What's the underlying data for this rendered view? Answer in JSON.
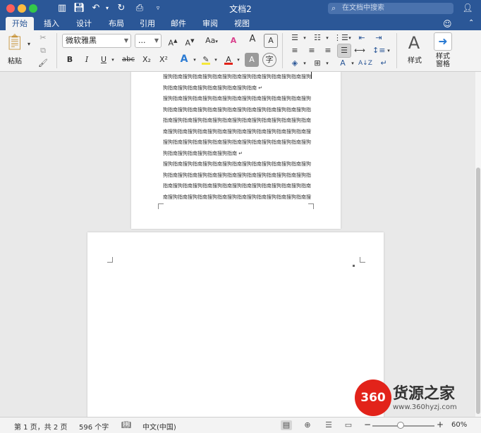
{
  "window": {
    "title": "文档2",
    "search_placeholder": "在文档中搜索"
  },
  "tabs": [
    "开始",
    "插入",
    "设计",
    "布局",
    "引用",
    "邮件",
    "审阅",
    "视图"
  ],
  "active_tab": "开始",
  "ribbon": {
    "paste_label": "粘贴",
    "font_name": "微软雅黑",
    "font_size": "...",
    "grow_font": "A",
    "shrink_font": "A",
    "aa_label": "Aa",
    "clear_format": "A",
    "phonetic": "A",
    "bold": "B",
    "italic": "I",
    "underline": "U",
    "strikethrough": "abc",
    "subscript": "X₂",
    "superscript": "X²",
    "text_effects": "A",
    "font_color": "A",
    "char_shading": "A",
    "enclose_char": "字",
    "styles_label": "样式",
    "styles_pane_label": "样式\n窗格",
    "highlight_color": "#f5e83a",
    "font_color_value": "#e2231a",
    "accent": "#2b5797"
  },
  "document": {
    "paragraphs": [
      [
        "搜狗指南搜狗指南搜狗指南搜狗指南搜狗指南搜狗指南搜狗指南搜狗指南搜",
        "狗指南搜狗指南搜狗指南搜狗指南搜狗指南 ↵"
      ],
      [
        "搜狗指南搜狗指南搜狗指南搜狗指南搜狗指南搜狗指南搜狗指南搜狗指南搜",
        "狗指南搜狗指南搜狗指南搜狗指南搜狗指南搜狗指南搜狗指南搜狗指南搜狗",
        "指南搜狗指南搜狗指南搜狗指南搜狗指南搜狗指南搜狗指南搜狗指南搜狗指",
        "南搜狗指南搜狗指南搜狗指南搜狗指南搜狗指南搜狗指南搜狗指南搜狗指南",
        "搜狗指南搜狗指南搜狗指南搜狗指南搜狗指南搜狗指南搜狗指南搜狗指南搜",
        "狗指南搜狗指南搜狗指南搜狗指南 ↵"
      ],
      [
        "搜狗指南搜狗指南搜狗指南搜狗指南搜狗指南搜狗指南搜狗指南搜狗指南搜",
        "狗指南搜狗指南搜狗指南搜狗指南搜狗指南搜狗指南搜狗指南搜狗指南搜狗",
        "指南搜狗指南搜狗指南搜狗指南搜狗指南搜狗指南搜狗指南搜狗指南搜狗指",
        "南搜狗指南搜狗指南搜狗指南搜狗指南搜狗指南搜狗指南搜狗指南搜狗指南 ↵"
      ]
    ]
  },
  "status": {
    "page": "第 1 页，共 2 页",
    "words": "596 个字",
    "language": "中文(中国)",
    "zoom": "60%",
    "zoom_value": 60
  },
  "watermark": {
    "badge": "360",
    "title": "货源之家",
    "url": "www.360hyzj.com"
  }
}
